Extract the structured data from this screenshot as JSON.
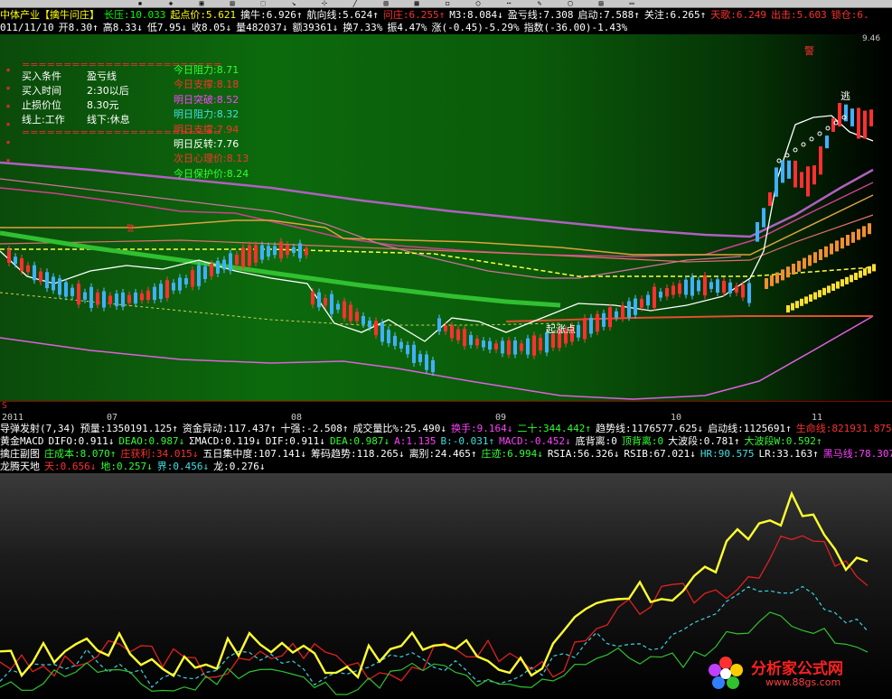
{
  "toolbar": {
    "items": [
      "▪",
      "◈",
      "▣",
      "▤",
      "⬚",
      "↘",
      "⊹",
      "╱",
      "▥",
      "▦",
      "◻",
      "◯",
      "⋯",
      "✎",
      "▢",
      "▤",
      "▭"
    ]
  },
  "header": {
    "line1": [
      {
        "text": "中体产业【擒牛问庄】",
        "color": "#ffff00"
      },
      {
        "text": "长压:10.033",
        "color": "#00ff00"
      },
      {
        "text": "起点价:5.621",
        "color": "#ffff00"
      },
      {
        "text": "擒牛:6.926↑",
        "color": "#ffffff"
      },
      {
        "text": "航向线:5.624↑",
        "color": "#ffffff"
      },
      {
        "text": "问庄:6.255↑",
        "color": "#ff3030"
      },
      {
        "text": "M3:8.084↓",
        "color": "#ffffff"
      },
      {
        "text": "盈亏线:7.308",
        "color": "#ffffff"
      },
      {
        "text": "启动:7.588↑",
        "color": "#ffffff"
      },
      {
        "text": "关注:6.265↑",
        "color": "#ffffff"
      },
      {
        "text": "天歌:6.249",
        "color": "#ff3030"
      },
      {
        "text": "出击:5.603",
        "color": "#ff3030"
      },
      {
        "text": "锁仓:6.",
        "color": "#ff3030"
      }
    ],
    "line2": [
      {
        "text": "011/11/10",
        "color": "#ffffff"
      },
      {
        "text": "开8.30↑",
        "color": "#ffffff"
      },
      {
        "text": "高8.33↓",
        "color": "#ffffff"
      },
      {
        "text": "低7.95↓",
        "color": "#ffffff"
      },
      {
        "text": "收8.05↓",
        "color": "#ffffff"
      },
      {
        "text": "量482037↓",
        "color": "#ffffff"
      },
      {
        "text": "额39361↓",
        "color": "#ffffff"
      },
      {
        "text": "换7.33%",
        "color": "#ffffff"
      },
      {
        "text": "振4.47%",
        "color": "#ffffff"
      },
      {
        "text": "涨(-0.45)-5.29%",
        "color": "#ffffff"
      },
      {
        "text": "指数(-36.00)-1.43%",
        "color": "#ffffff"
      }
    ]
  },
  "main_panel": {
    "separator": "========================",
    "stars": [
      "★",
      "★",
      "★",
      "★",
      "★",
      "★"
    ],
    "rows": [
      {
        "k": "买入条件",
        "v": "盈亏线"
      },
      {
        "k": "买入时间",
        "v": "2:30以后"
      },
      {
        "k": "止损价位",
        "v": "8.30元"
      },
      {
        "k": "线上:工作",
        "v": "线下:休息"
      }
    ],
    "right": [
      {
        "text": "今日阻力:8.71",
        "color": "#30ff30"
      },
      {
        "text": "今日支撑:8.18",
        "color": "#ff3030"
      },
      {
        "text": "明日突破:8.52",
        "color": "#ff40ff"
      },
      {
        "text": "明日阻力:8.32",
        "color": "#40e0e0"
      },
      {
        "text": "明日支撑:7.94",
        "color": "#ff3030"
      },
      {
        "text": "明日反转:7.76",
        "color": "#ffffff"
      },
      {
        "text": "次日心理价:8.13",
        "color": "#ff3030"
      },
      {
        "text": "今日保护价:8.24",
        "color": "#30ff30"
      }
    ],
    "markers": {
      "qizhangdian": "起涨点",
      "tao": "逃",
      "jing1": "警",
      "jing2": "警",
      "top_price": "9.46"
    }
  },
  "xaxis": {
    "s_mark": "S",
    "labels": [
      "2011",
      "07",
      "08",
      "09",
      "10",
      "11"
    ]
  },
  "indicators": [
    [
      {
        "text": "导弹发射(7,34)",
        "color": "#ffffff"
      },
      {
        "text": "预量:1350191.125↑",
        "color": "#ffffff"
      },
      {
        "text": "资金异动:117.437↑",
        "color": "#ffffff"
      },
      {
        "text": "十强:-2.508↑",
        "color": "#ffffff"
      },
      {
        "text": "成交量比%:25.490↓",
        "color": "#ffffff"
      },
      {
        "text": "换手:9.164↓",
        "color": "#ff40ff"
      },
      {
        "text": "二十:344.442↑",
        "color": "#30ff30"
      },
      {
        "text": "趋势线:1176577.625↓",
        "color": "#ffffff"
      },
      {
        "text": "启动线:1125691↑",
        "color": "#ffffff"
      },
      {
        "text": "生命线:821931.875↑",
        "color": "#ff3030"
      }
    ],
    [
      {
        "text": "黄金MACD",
        "color": "#ffffff"
      },
      {
        "text": "DIFO:0.911↓",
        "color": "#ffffff"
      },
      {
        "text": "DEAO:0.987↓",
        "color": "#30ff30"
      },
      {
        "text": "ΣMACD:0.119↓",
        "color": "#ffffff"
      },
      {
        "text": "DIF:0.911↓",
        "color": "#ffffff"
      },
      {
        "text": "DEA:0.987↓",
        "color": "#30ff30"
      },
      {
        "text": "A:1.135",
        "color": "#ff40ff"
      },
      {
        "text": "B:-0.031↑",
        "color": "#40e0e0"
      },
      {
        "text": "MACD:-0.452↓",
        "color": "#ff40ff"
      },
      {
        "text": "底背离:0",
        "color": "#ffffff"
      },
      {
        "text": "顶背离:0",
        "color": "#30ff30"
      },
      {
        "text": "大波段:0.781↑",
        "color": "#ffffff"
      },
      {
        "text": "大波段W:0.592↑",
        "color": "#30ff30"
      }
    ],
    [
      {
        "text": "擒庄副图",
        "color": "#ffffff"
      },
      {
        "text": "庄成本:8.070↑",
        "color": "#30ff30"
      },
      {
        "text": "庄获利:34.015↓",
        "color": "#ff3030"
      },
      {
        "text": "五日集中度:107.141↓",
        "color": "#ffffff"
      },
      {
        "text": "筹码趋势:118.265↓",
        "color": "#ffffff"
      },
      {
        "text": "离别:24.465↑",
        "color": "#ffffff"
      },
      {
        "text": "庄迹:6.994↓",
        "color": "#30ff30"
      },
      {
        "text": "RSIA:56.326↓",
        "color": "#ffffff"
      },
      {
        "text": "RSIB:67.021↓",
        "color": "#ffffff"
      },
      {
        "text": "HR:90.575",
        "color": "#40e0e0"
      },
      {
        "text": "LR:33.163↑",
        "color": "#ffffff"
      },
      {
        "text": "黑马线:78.307↓",
        "color": "#ff40ff"
      }
    ],
    [
      {
        "text": "龙腾天地",
        "color": "#ffffff"
      },
      {
        "text": "天:0.656↓",
        "color": "#ff3030"
      },
      {
        "text": "地:0.257↓",
        "color": "#30ff30"
      },
      {
        "text": "界:0.456↓",
        "color": "#40e0e0"
      },
      {
        "text": "龙:0.276↓",
        "color": "#ffffff"
      }
    ]
  ],
  "logo": {
    "name": "分析家公式网",
    "url": "www.88gs.com"
  }
}
